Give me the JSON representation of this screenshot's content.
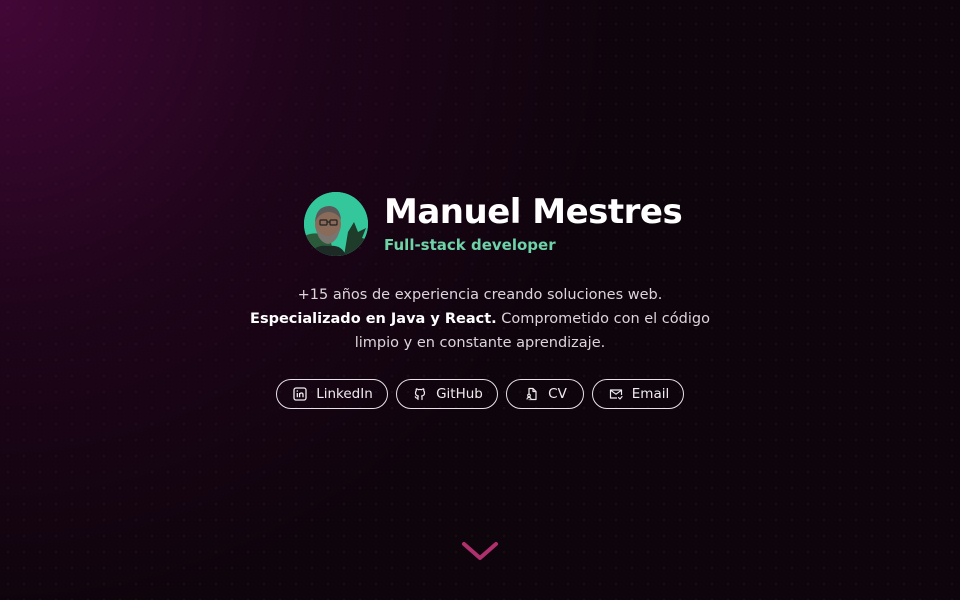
{
  "profile": {
    "name": "Manuel Mestres",
    "role": "Full-stack developer",
    "avatar_alt": "Manuel Mestres"
  },
  "bio": {
    "line1": "+15 años de experiencia creando soluciones web.",
    "highlight": "Especializado en Java y React.",
    "rest": " Comprometido con el código limpio y en constante aprendizaje."
  },
  "links": [
    {
      "label": "LinkedIn",
      "icon": "linkedin-icon"
    },
    {
      "label": "GitHub",
      "icon": "github-icon"
    },
    {
      "label": "CV",
      "icon": "document-icon"
    },
    {
      "label": "Email",
      "icon": "mail-icon"
    }
  ],
  "scroll": {
    "icon": "chevron-down-icon"
  },
  "colors": {
    "background": "#0e040c",
    "glow": "#6e0a5a",
    "accent_green": "#6fd3a8",
    "chevron": "#b0306e"
  }
}
